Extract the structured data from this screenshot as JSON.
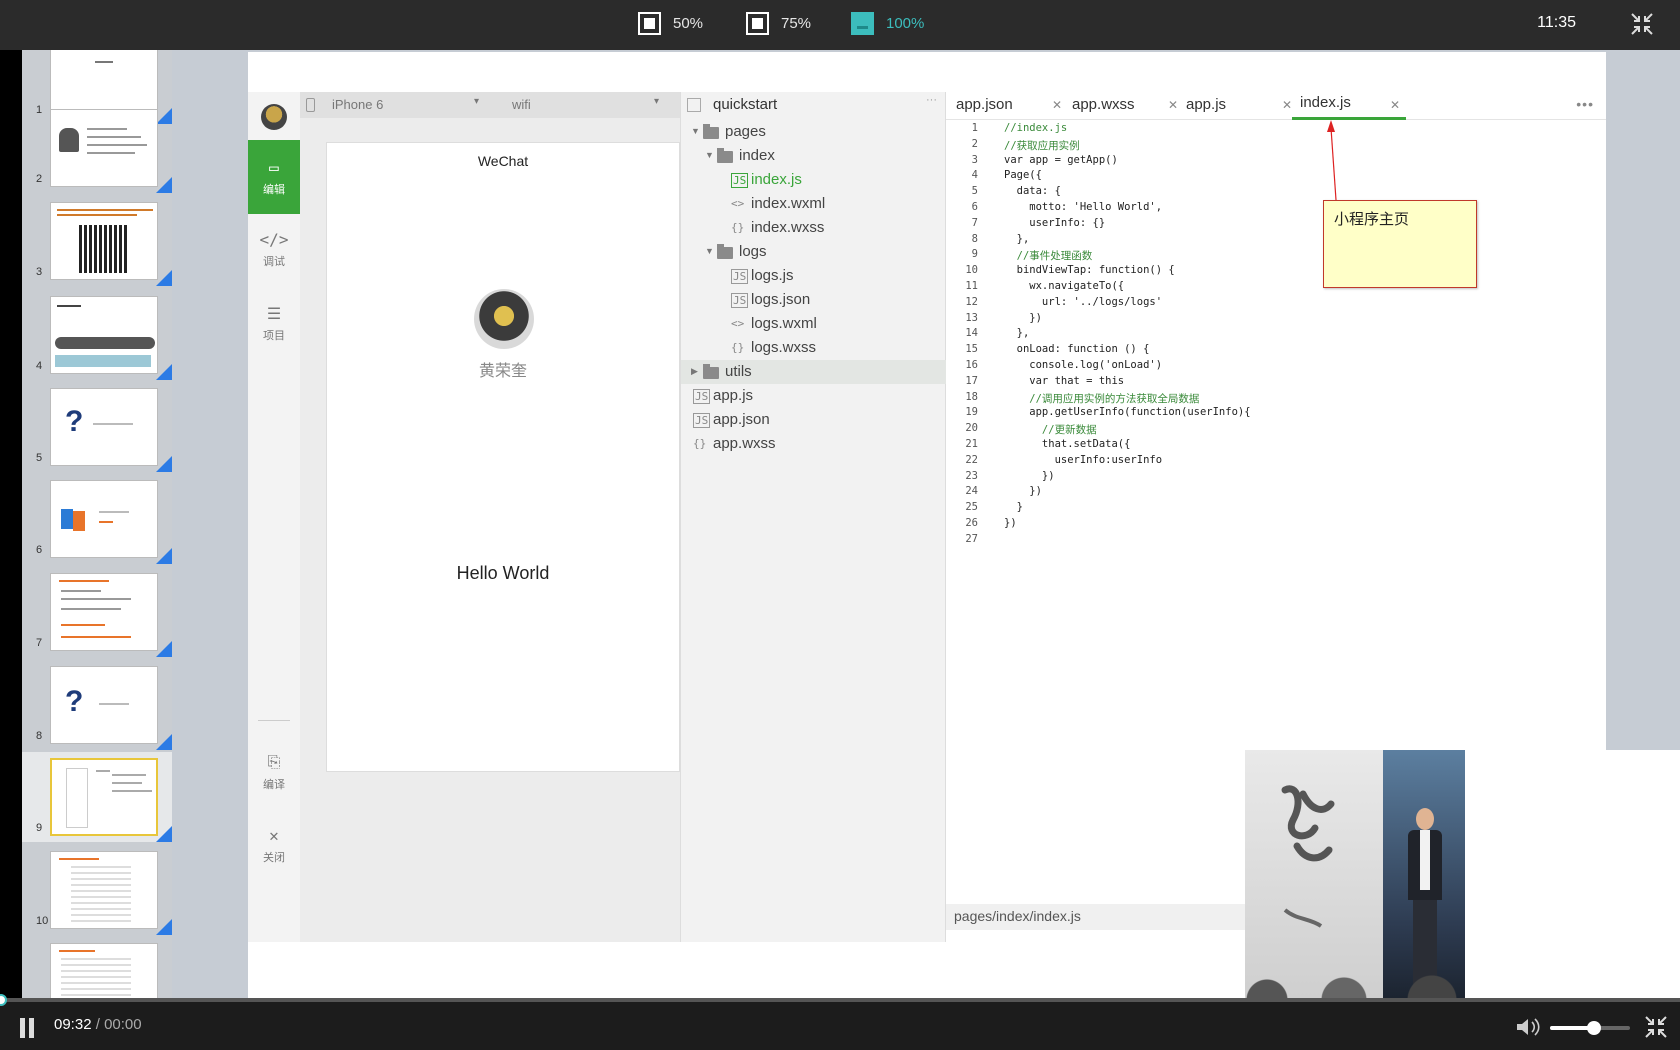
{
  "topbar": {
    "zoom_options": [
      {
        "label": "50%"
      },
      {
        "label": "75%"
      },
      {
        "label": "100%"
      }
    ],
    "active_zoom": "100%",
    "clock": "11:35"
  },
  "thumbnails": [
    {
      "num": "1"
    },
    {
      "num": "2"
    },
    {
      "num": "3"
    },
    {
      "num": "4"
    },
    {
      "num": "5"
    },
    {
      "num": "6"
    },
    {
      "num": "7"
    },
    {
      "num": "8"
    },
    {
      "num": "9"
    },
    {
      "num": "10"
    }
  ],
  "active_slide": 9,
  "ide": {
    "leftbar": {
      "edit_label": "编辑",
      "debug_label": "调试",
      "project_label": "项目",
      "compile_label": "编译",
      "close_label": "关闭"
    },
    "simulator": {
      "device": "iPhone 6",
      "network": "wifi",
      "title": "WeChat",
      "nickname": "黄荣奎",
      "motto": "Hello World"
    },
    "tree": {
      "project_name": "quickstart",
      "items": [
        {
          "label": "pages"
        },
        {
          "label": "index"
        },
        {
          "label": "index.js"
        },
        {
          "label": "index.wxml"
        },
        {
          "label": "index.wxss"
        },
        {
          "label": "logs"
        },
        {
          "label": "logs.js"
        },
        {
          "label": "logs.json"
        },
        {
          "label": "logs.wxml"
        },
        {
          "label": "logs.wxss"
        },
        {
          "label": "utils"
        },
        {
          "label": "app.js"
        },
        {
          "label": "app.json"
        },
        {
          "label": "app.wxss"
        }
      ]
    },
    "editor": {
      "tabs": [
        {
          "label": "app.json"
        },
        {
          "label": "app.wxss"
        },
        {
          "label": "app.js"
        },
        {
          "label": "index.js"
        }
      ],
      "active_tab": "index.js",
      "code_lines": [
        {
          "n": "1",
          "t": "//index.js"
        },
        {
          "n": "2",
          "t": "//获取应用实例"
        },
        {
          "n": "3",
          "t": "var app = getApp()"
        },
        {
          "n": "4",
          "t": "Page({"
        },
        {
          "n": "5",
          "t": "  data: {"
        },
        {
          "n": "6",
          "t": "    motto: 'Hello World',"
        },
        {
          "n": "7",
          "t": "    userInfo: {}"
        },
        {
          "n": "8",
          "t": "  },"
        },
        {
          "n": "9",
          "t": "  //事件处理函数"
        },
        {
          "n": "10",
          "t": "  bindViewTap: function() {"
        },
        {
          "n": "11",
          "t": "    wx.navigateTo({"
        },
        {
          "n": "12",
          "t": "      url: '../logs/logs'"
        },
        {
          "n": "13",
          "t": "    })"
        },
        {
          "n": "14",
          "t": "  },"
        },
        {
          "n": "15",
          "t": "  onLoad: function () {"
        },
        {
          "n": "16",
          "t": "    console.log('onLoad')"
        },
        {
          "n": "17",
          "t": "    var that = this"
        },
        {
          "n": "18",
          "t": "    //调用应用实例的方法获取全局数据"
        },
        {
          "n": "19",
          "t": "    app.getUserInfo(function(userInfo){"
        },
        {
          "n": "20",
          "t": "      //更新数据"
        },
        {
          "n": "21",
          "t": "      that.setData({"
        },
        {
          "n": "22",
          "t": "        userInfo:userInfo"
        },
        {
          "n": "23",
          "t": "      })"
        },
        {
          "n": "24",
          "t": "    })"
        },
        {
          "n": "25",
          "t": "  }"
        },
        {
          "n": "26",
          "t": "})"
        },
        {
          "n": "27",
          "t": ""
        }
      ],
      "status_path": "pages/index/index.js"
    }
  },
  "callout": {
    "text": "小程序主页"
  },
  "player": {
    "current_time": "09:32",
    "separator": "/",
    "duration": "00:00",
    "progress": 0.0,
    "volume": 0.55
  },
  "colors": {
    "accent": "#3cbdbd",
    "ide_green": "#3aa53a",
    "note_bg": "#ffffc8",
    "note_border": "#c0392b"
  },
  "icons": {
    "pause": "pause-icon",
    "volume": "volume-icon",
    "compress": "compress-icon",
    "folder": "folder-icon",
    "file": "file-icon"
  }
}
